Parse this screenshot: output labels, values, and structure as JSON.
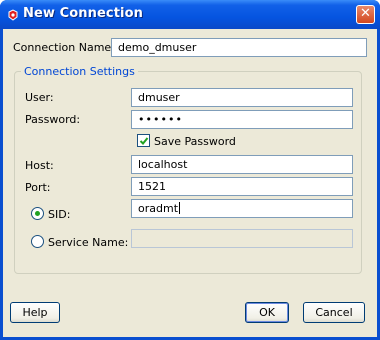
{
  "window": {
    "title": "New Connection",
    "app_icon": "oracle-red-icon",
    "close_glyph": "✕"
  },
  "form": {
    "connection_name_label": "Connection Name:",
    "connection_name_value": "demo_dmuser",
    "group_title": "Connection Settings",
    "user_label": "User:",
    "user_value": "dmuser",
    "password_label": "Password:",
    "password_value": "••••••",
    "save_password_label": "Save Password",
    "save_password_checked": true,
    "host_label": "Host:",
    "host_value": "localhost",
    "port_label": "Port:",
    "port_value": "1521",
    "sid_label": "SID:",
    "sid_value": "oradmt",
    "sid_selected": true,
    "service_name_label": "Service Name:",
    "service_name_value": ""
  },
  "buttons": {
    "help": "Help",
    "ok": "OK",
    "cancel": "Cancel"
  },
  "colors": {
    "title_bar": "#0554e0",
    "dialog_bg": "#ece9d8",
    "group_title": "#0046d5",
    "radio_dot": "#21a121",
    "close_button": "#d3471f"
  }
}
